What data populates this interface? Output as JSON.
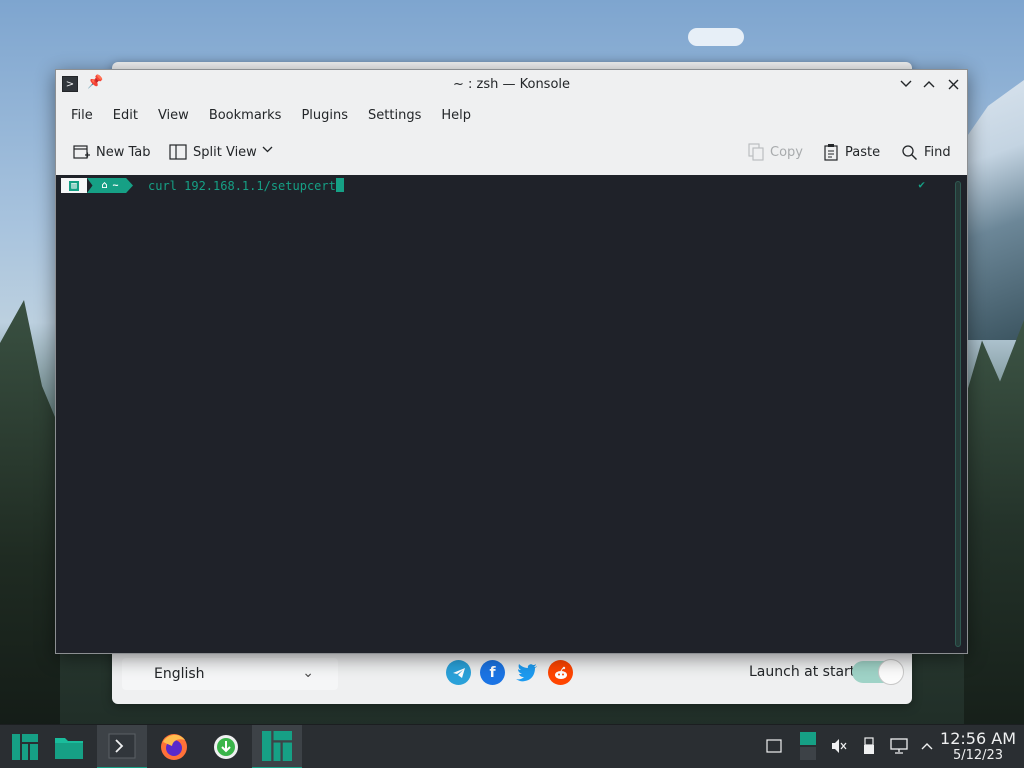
{
  "konsole": {
    "title": "~ : zsh — Konsole",
    "menu": [
      "File",
      "Edit",
      "View",
      "Bookmarks",
      "Plugins",
      "Settings",
      "Help"
    ],
    "toolbar": {
      "new_tab": "New Tab",
      "split_view": "Split View",
      "copy": "Copy",
      "paste": "Paste",
      "find": "Find"
    },
    "terminal": {
      "prompt_dir": "~",
      "command": "curl 192.168.1.1/setupcert",
      "status_mark": "✔"
    }
  },
  "background_app": {
    "language": "English",
    "launch_label": "Launch at start",
    "launch_at_start": true
  },
  "taskbar": {
    "time": "12:56 AM",
    "date": "5/12/23"
  },
  "colors": {
    "accent": "#16a085",
    "terminal_bg": "#1f2229",
    "taskbar_bg": "#2a2e32"
  }
}
